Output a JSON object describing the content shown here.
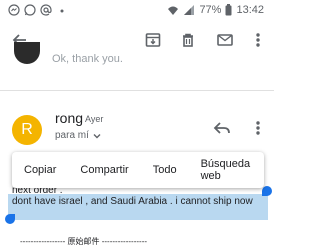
{
  "status_bar": {
    "battery_text": "77%",
    "time": "13:42",
    "left_icons": [
      "messenger-icon",
      "whatsapp-icon",
      "mail-icon",
      "dot-icon"
    ],
    "right_icons": [
      "wifi-icon",
      "signal-icon",
      "battery-icon"
    ]
  },
  "toolbar": {
    "icons": [
      "back-arrow-icon",
      "archive-icon",
      "delete-icon",
      "mail-icon",
      "more-vert-icon"
    ]
  },
  "previous_message": {
    "snippet": "Ok, thank you."
  },
  "message": {
    "avatar_letter": "R",
    "avatar_color": "#f4b400",
    "sender": "rong",
    "date": "Ayer",
    "recipient": "para mí",
    "body_line1": "next order .",
    "selected_line1": "dont have israel , and Saudi Arabia . i cannot ship now",
    "selected_line2": ".",
    "original_header": "----------------- 原始邮件 -----------------"
  },
  "context_menu": {
    "items": [
      "Copiar",
      "Compartir",
      "Todo",
      "Búsqueda web"
    ]
  },
  "colors": {
    "selection": "#b9d8f0",
    "handle": "#1a73e8"
  }
}
